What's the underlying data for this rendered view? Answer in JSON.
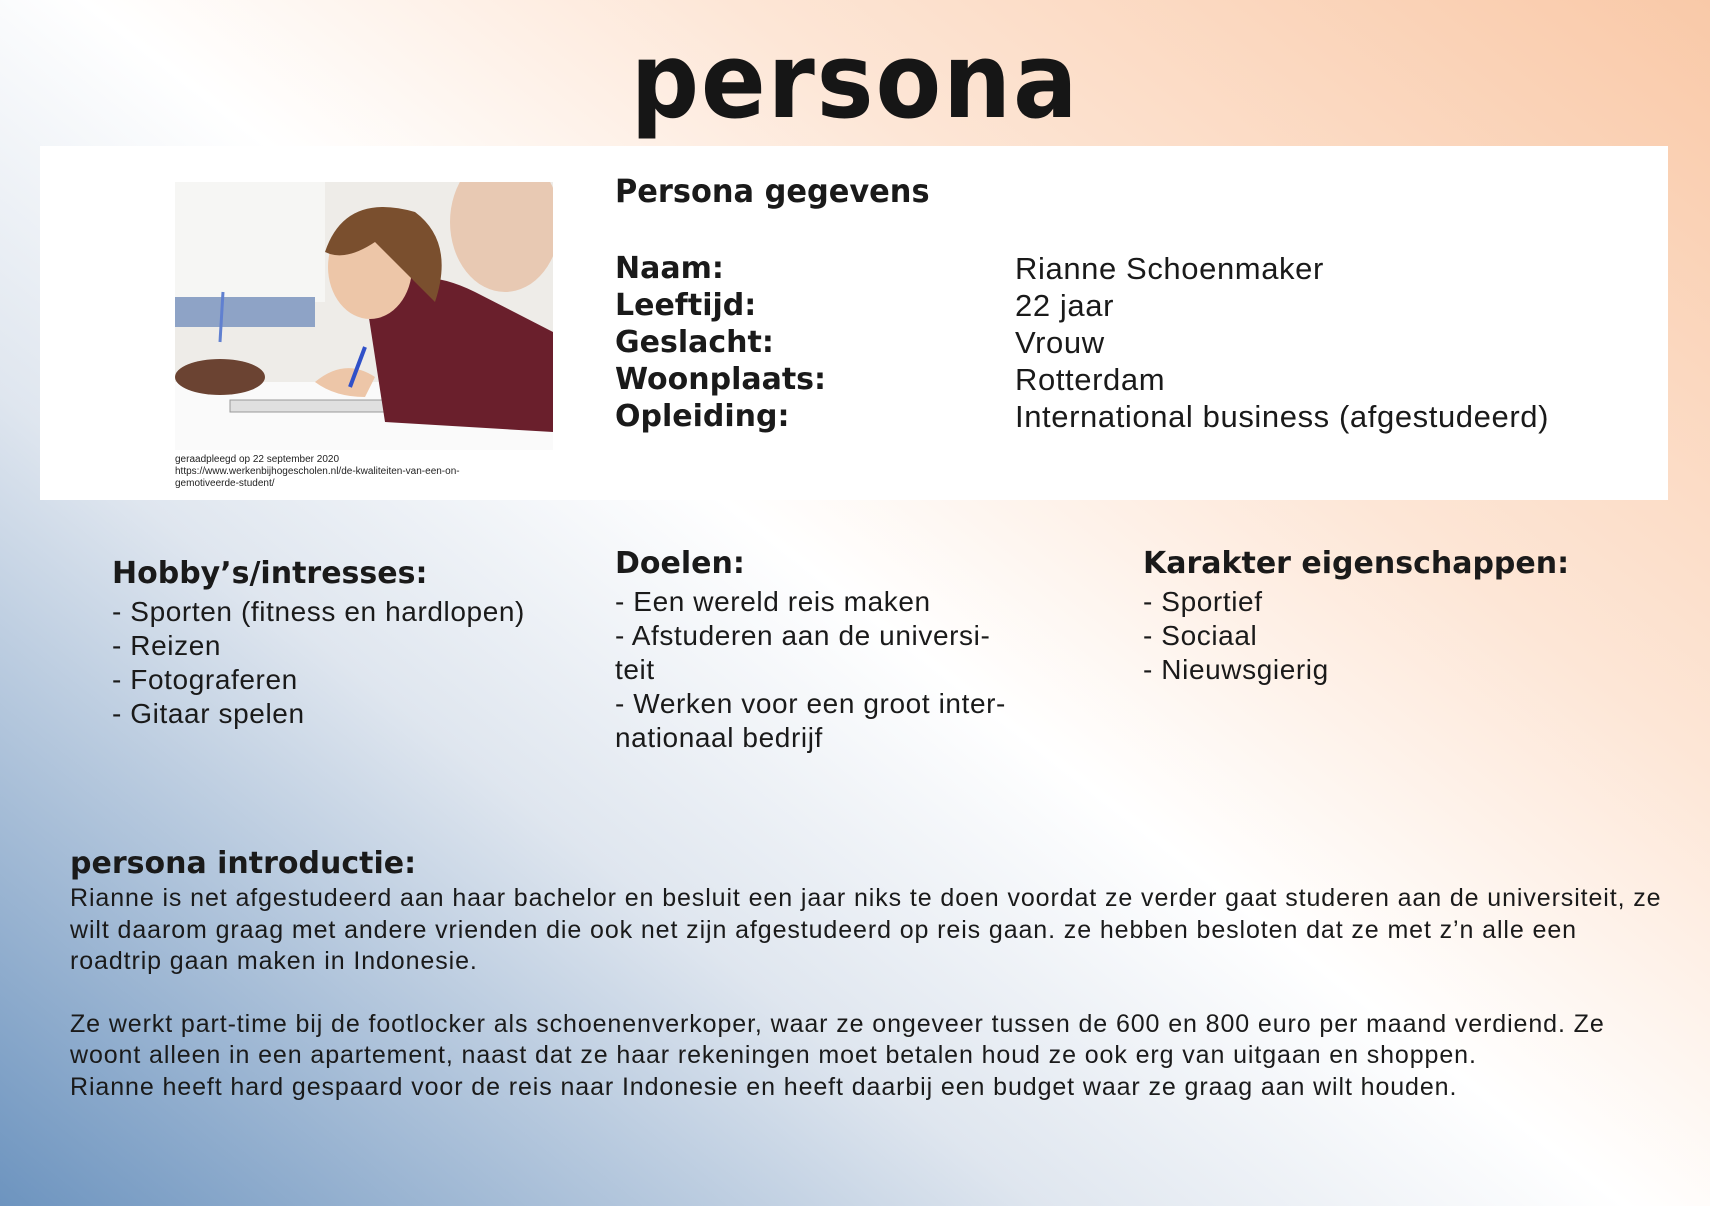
{
  "page": {
    "title": "persona"
  },
  "profile": {
    "heading": "Persona gegevens",
    "photo_caption": [
      "geraadpleegd op 22 september 2020",
      "https://www.werkenbijhogescholen.nl/de-kwaliteiten-van-een-on-",
      "gemotiveerde-student/"
    ],
    "fields": [
      {
        "label": "Naam:",
        "value": "Rianne Schoenmaker"
      },
      {
        "label": "Leeftijd:",
        "value": "22 jaar"
      },
      {
        "label": "Geslacht:",
        "value": "Vrouw"
      },
      {
        "label": "Woonplaats:",
        "value": "Rotterdam"
      },
      {
        "label": "Opleiding:",
        "value": "International business (afgestudeerd)"
      }
    ]
  },
  "hobbies": {
    "heading": "Hobby’s/intresses:",
    "items": [
      "- Sporten (fitness en hardlopen)",
      "- Reizen",
      "- Fotograferen",
      "- Gitaar spelen"
    ]
  },
  "goals": {
    "heading": "Doelen:",
    "items": [
      "- Een wereld reis maken",
      "- Afstuderen aan de universi-\nteit",
      "- Werken voor een groot inter-\nnationaal bedrijf"
    ]
  },
  "traits": {
    "heading": "Karakter eigenschappen:",
    "items": [
      "- Sportief",
      "- Sociaal",
      "- Nieuwsgierig"
    ]
  },
  "intro": {
    "heading": "persona introductie:",
    "paragraphs": [
      "Rianne is net afgestudeerd aan haar bachelor en besluit een jaar niks te doen voordat ze verder gaat studeren aan de universiteit, ze wilt daarom graag met andere vrienden die ook net zijn afgestudeerd op reis gaan. ze hebben besloten dat ze met z’n alle een roadtrip gaan maken in Indonesie.",
      "Ze werkt part-time bij de footlocker als schoenenverkoper, waar ze ongeveer tussen de 600 en 800 euro per maand verdiend. Ze woont alleen in een apartement, naast dat ze haar rekeningen moet betalen houd ze ook erg van uitgaan en shoppen.",
      "Rianne heeft hard gespaard voor de reis naar Indonesie en heeft daarbij een budget waar ze graag aan wilt houden."
    ]
  }
}
